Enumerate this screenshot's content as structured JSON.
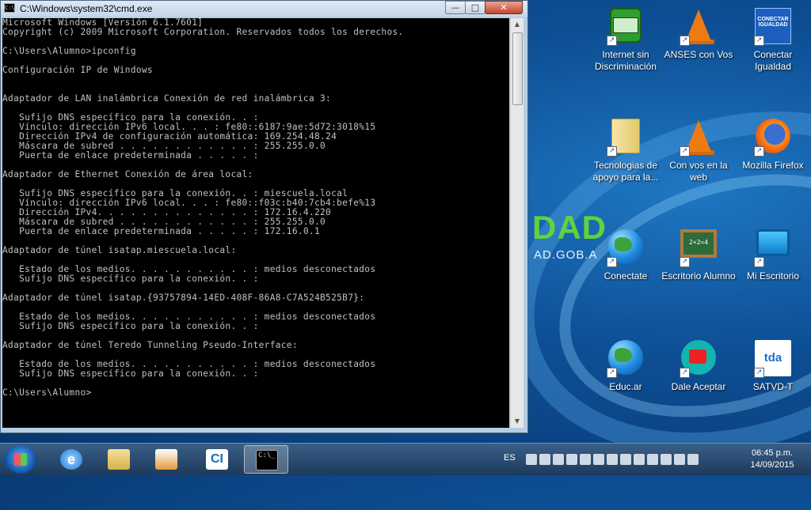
{
  "desktop": {
    "brand_big": "DAD",
    "brand_small": "AD.GOB.A",
    "icons": [
      {
        "label": "Internet sin Discriminación",
        "icon": "robot-icon"
      },
      {
        "label": "ANSES con Vos",
        "icon": "vlc-cone-icon"
      },
      {
        "label": "Conectar Igualdad",
        "icon": "conectar-igualdad-icon",
        "icon_text": "CONECTAR IGUALDAD"
      },
      {
        "label": "Tecnologias de apoyo para la...",
        "icon": "folder-icon"
      },
      {
        "label": "Con vos en la web",
        "icon": "vlc-cone-icon"
      },
      {
        "label": "Mozilla Firefox",
        "icon": "firefox-icon"
      },
      {
        "label": "Conectate",
        "icon": "globe-icon"
      },
      {
        "label": "Escritorio Alumno",
        "icon": "chalkboard-icon",
        "icon_text": "2+2=4"
      },
      {
        "label": "Mi Escritorio",
        "icon": "monitor-icon"
      },
      {
        "label": "Educ.ar",
        "icon": "globe-icon"
      },
      {
        "label": "Dale Aceptar",
        "icon": "dale-aceptar-icon"
      },
      {
        "label": "SATVD-T",
        "icon": "tda-icon",
        "icon_text": "tda"
      }
    ]
  },
  "window": {
    "title": "C:\\Windows\\system32\\cmd.exe",
    "buttons": {
      "minimize": "—",
      "maximize": "□",
      "close": "✕"
    },
    "icon_text": "C:\\",
    "lines": [
      "Microsoft Windows [Versión 6.1.7601]",
      "Copyright (c) 2009 Microsoft Corporation. Reservados todos los derechos.",
      "",
      "C:\\Users\\Alumno>ipconfig",
      "",
      "Configuración IP de Windows",
      "",
      "",
      "Adaptador de LAN inalámbrica Conexión de red inalámbrica 3:",
      "",
      "   Sufijo DNS específico para la conexión. . :",
      "   Vínculo: dirección IPv6 local. . . : fe80::6187:9ae:5d72:3018%15",
      "   Dirección IPv4 de configuración automática: 169.254.48.24",
      "   Máscara de subred . . . . . . . . . . . . : 255.255.0.0",
      "   Puerta de enlace predeterminada . . . . . :",
      "",
      "Adaptador de Ethernet Conexión de área local:",
      "",
      "   Sufijo DNS específico para la conexión. . : miescuela.local",
      "   Vínculo: dirección IPv6 local. . . : fe80::f03c:b40:7cb4:befe%13",
      "   Dirección IPv4. . . . . . . . . . . . . . : 172.16.4.220",
      "   Máscara de subred . . . . . . . . . . . . : 255.255.0.0",
      "   Puerta de enlace predeterminada . . . . . : 172.16.0.1",
      "",
      "Adaptador de túnel isatap.miescuela.local:",
      "",
      "   Estado de los medios. . . . . . . . . . . : medios desconectados",
      "   Sufijo DNS específico para la conexión. . :",
      "",
      "Adaptador de túnel isatap.{93757894-14ED-408F-86A8-C7A524B525B7}:",
      "",
      "   Estado de los medios. . . . . . . . . . . : medios desconectados",
      "   Sufijo DNS específico para la conexión. . :",
      "",
      "Adaptador de túnel Teredo Tunneling Pseudo-Interface:",
      "",
      "   Estado de los medios. . . . . . . . . . . : medios desconectados",
      "   Sufijo DNS específico para la conexión. . :",
      "",
      "C:\\Users\\Alumno>"
    ]
  },
  "taskbar": {
    "ie_text": "e",
    "ci_text": "CI",
    "cmd_text": "C:\\_",
    "language": "ES",
    "time": "06:45 p.m.",
    "date": "14/09/2015"
  },
  "colors": {
    "console_bg": "#000000",
    "console_text": "#c0c0c0",
    "desktop": "#0d4f95"
  }
}
